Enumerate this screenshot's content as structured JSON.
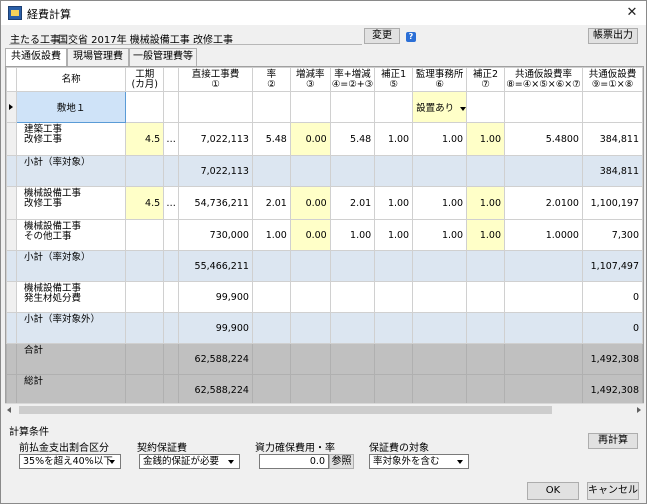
{
  "window": {
    "title": "経費計算",
    "close": "✕"
  },
  "header": {
    "label": "主たる工事",
    "value": "国交省 2017年 機械設備工事 改修工事",
    "change_button": "変更",
    "help": "?",
    "report_button": "帳票出力"
  },
  "tabs": [
    "共通仮設費",
    "現場管理費",
    "一般管理費等"
  ],
  "columns": [
    "名称",
    "工期\n(カ月)",
    "",
    "直接工事費\n①",
    "率\n②",
    "増減率\n③",
    "率+増減\n④=②+③",
    "補正1\n⑤",
    "監理事務所\n⑥",
    "補正2\n⑦",
    "共通仮設費率\n⑧=④×⑤×⑥×⑦",
    "共通仮設費\n⑨=①×⑧"
  ],
  "rows": [
    {
      "type": "location",
      "name": "敷地１",
      "dropdown": "設置あり"
    },
    {
      "type": "item",
      "name": "建築工事\n改修工事",
      "period": "4.5",
      "dots": "…",
      "direct": "7,022,113",
      "rate": "5.48",
      "adj": "0.00",
      "rate_adj": "5.48",
      "corr1": "1.00",
      "office": "1.00",
      "corr2": "1.00",
      "temp_rate": "5.4800",
      "temp": "384,811"
    },
    {
      "type": "sub",
      "name": "小計（率対象）",
      "direct": "7,022,113",
      "temp": "384,811"
    },
    {
      "type": "item",
      "name": "機械設備工事\n改修工事",
      "period": "4.5",
      "dots": "…",
      "direct": "54,736,211",
      "rate": "2.01",
      "adj": "0.00",
      "rate_adj": "2.01",
      "corr1": "1.00",
      "office": "1.00",
      "corr2": "1.00",
      "temp_rate": "2.0100",
      "temp": "1,100,197"
    },
    {
      "type": "item2",
      "name": "機械設備工事\nその他工事",
      "direct": "730,000",
      "rate": "1.00",
      "adj": "0.00",
      "rate_adj": "1.00",
      "corr1": "1.00",
      "office": "1.00",
      "corr2": "1.00",
      "temp_rate": "1.0000",
      "temp": "7,300"
    },
    {
      "type": "sub",
      "name": "小計（率対象）",
      "direct": "55,466,211",
      "temp": "1,107,497"
    },
    {
      "type": "plain",
      "name": "機械設備工事\n発生材処分費",
      "direct": "99,900",
      "temp": "0"
    },
    {
      "type": "sub",
      "name": "小計（率対象外）",
      "direct": "99,900",
      "temp": "0"
    },
    {
      "type": "tot",
      "name": "合計",
      "direct": "62,588,224",
      "temp": "1,492,308"
    },
    {
      "type": "tot",
      "name": "総計",
      "direct": "62,588,224",
      "temp": "1,492,308"
    }
  ],
  "conditions": {
    "section_label": "計算条件",
    "prepay_label": "前払金支出割合区分",
    "prepay_value": "35%を超え40%以下",
    "guarantee_label": "契約保証費",
    "guarantee_value": "金銭的保証が必要",
    "funding_label": "資力確保費用・率",
    "funding_value": "0.0",
    "ref_button": "参照",
    "target_label": "保証費の対象",
    "target_value": "率対象外を含む",
    "recalc_button": "再計算"
  },
  "footer": {
    "ok": "OK",
    "cancel": "キャンセル"
  }
}
